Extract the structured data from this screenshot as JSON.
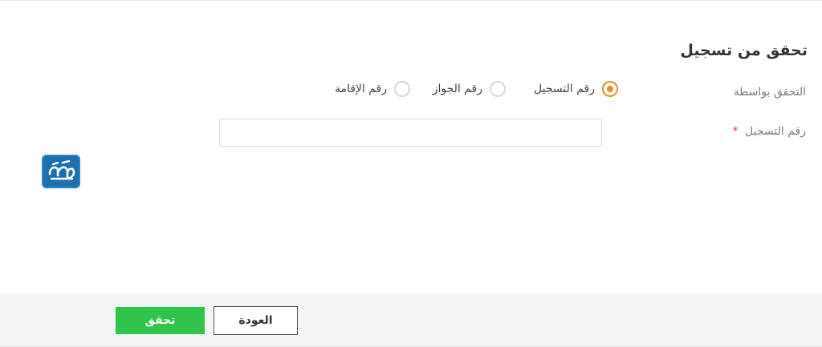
{
  "form": {
    "title": "تحقق من تسجيل",
    "verify_by_label": "التحقق بواسطة",
    "registration_number_label": "رقم التسجيل",
    "required_marker": "*",
    "registration_number_value": "",
    "registration_number_placeholder": "",
    "options": [
      {
        "label": "رقم التسجيل",
        "selected": true
      },
      {
        "label": "رقم الجواز",
        "selected": false
      },
      {
        "label": "رقم الإقامة",
        "selected": false
      }
    ],
    "accent_color": "#f0892d"
  },
  "footer": {
    "verify_label": "تحقق",
    "back_label": "العودة",
    "verify_color": "#2fc54b"
  },
  "logo": {
    "text": "المرجع",
    "icon": "marjaa-logo-icon"
  }
}
